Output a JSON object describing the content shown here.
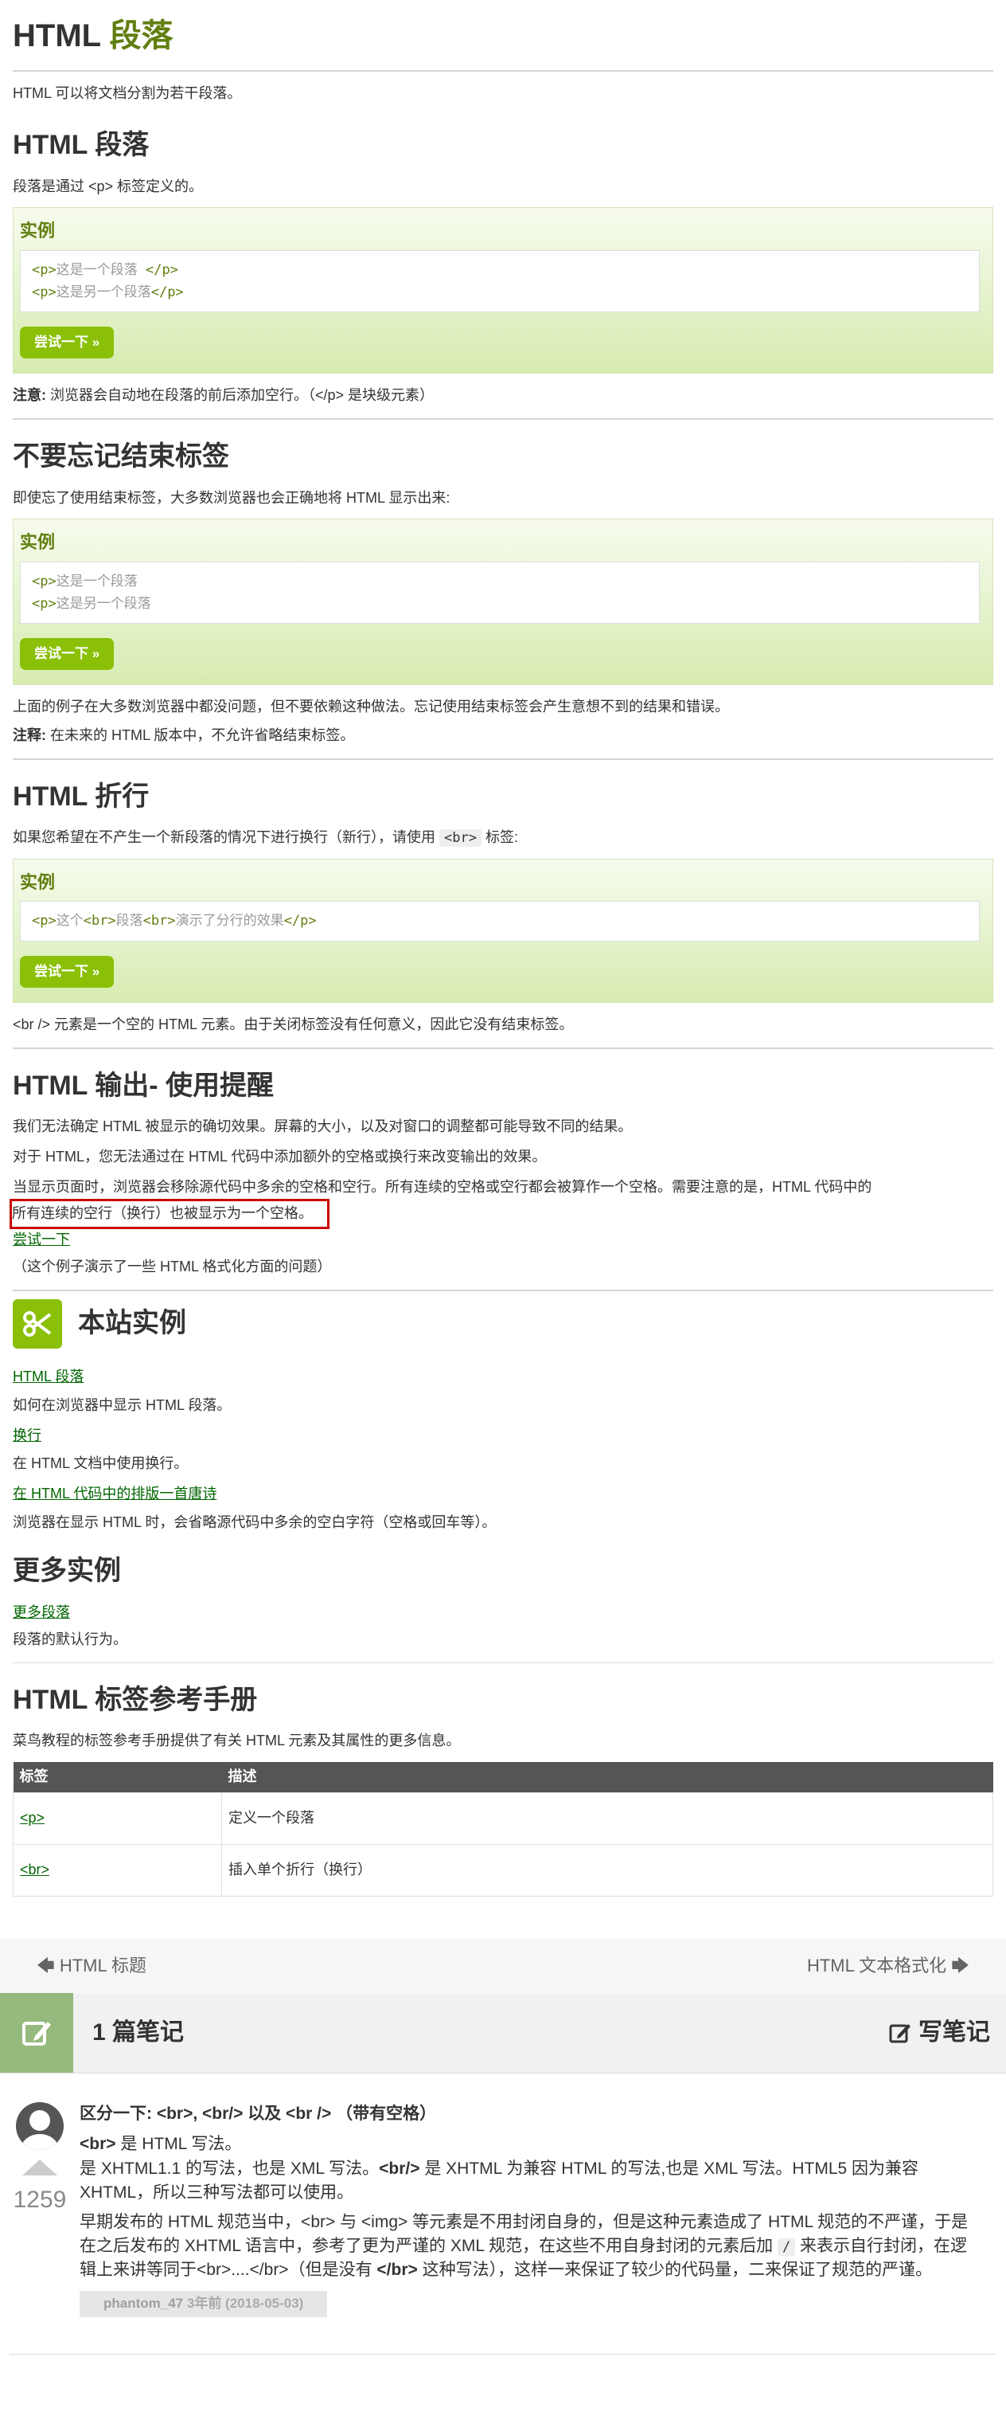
{
  "page": {
    "title_prefix": "HTML",
    "title_accent": "段落",
    "intro": "HTML 可以将文档分割为若干段落。"
  },
  "sections": {
    "s1": {
      "title": "HTML 段落",
      "desc": "段落是通过 <p> 标签定义的。",
      "example_label": "实例",
      "code": [
        {
          "open": "<p>",
          "text": "这是一个段落 ",
          "close": "</p>"
        },
        {
          "open": "<p>",
          "text": "这是另一个段落",
          "close": "</p>"
        }
      ],
      "try_label": "尝试一下 »",
      "note_label": "注意:",
      "note_text": " 浏览器会自动地在段落的前后添加空行。（</p> 是块级元素）"
    },
    "s2": {
      "title": "不要忘记结束标签",
      "desc": "即使忘了使用结束标签，大多数浏览器也会正确地将 HTML 显示出来:",
      "example_label": "实例",
      "code": [
        {
          "open": "<p>",
          "text": "这是一个段落",
          "close": ""
        },
        {
          "open": "<p>",
          "text": "这是另一个段落",
          "close": ""
        }
      ],
      "try_label": "尝试一下 »",
      "after": "上面的例子在大多数浏览器中都没问题，但不要依赖这种做法。忘记使用结束标签会产生意想不到的结果和错误。",
      "note_label": "注释:",
      "note_text": " 在未来的 HTML 版本中，不允许省略结束标签。"
    },
    "s3": {
      "title": "HTML 折行",
      "desc_before": "如果您希望在不产生一个新段落的情况下进行换行（新行），请使用 ",
      "desc_code": "<br>",
      "desc_after": " 标签:",
      "example_label": "实例",
      "code_parts": [
        "<p>",
        "这个",
        "<br>",
        "段落",
        "<br>",
        "演示了分行的效果",
        "</p>"
      ],
      "try_label": "尝试一下 »",
      "after": "<br /> 元素是一个空的 HTML 元素。由于关闭标签没有任何意义，因此它没有结束标签。"
    },
    "s4": {
      "title": "HTML 输出- 使用提醒",
      "p1": "我们无法确定 HTML 被显示的确切效果。屏幕的大小，以及对窗口的调整都可能导致不同的结果。",
      "p2": "对于 HTML，您无法通过在 HTML 代码中添加额外的空格或换行来改变输出的效果。",
      "p3": "当显示页面时，浏览器会移除源代码中多余的空格和空行。所有连续的空格或空行都会被算作一个空格。需要注意的是，HTML 代码中的",
      "p3_highlight": "所有连续的空行（换行）也被显示为一个空格。",
      "try_link": "尝试一下",
      "p4": "（这个例子演示了一些 HTML 格式化方面的问题）"
    },
    "site_examples": {
      "title": "本站实例",
      "items": [
        {
          "link": "HTML 段落",
          "desc": "如何在浏览器中显示 HTML 段落。"
        },
        {
          "link": "换行",
          "desc": "在 HTML 文档中使用换行。"
        },
        {
          "link": "在 HTML 代码中的排版一首唐诗",
          "desc": "浏览器在显示 HTML 时，会省略源代码中多余的空白字符（空格或回车等）。"
        }
      ]
    },
    "more_examples": {
      "title": "更多实例",
      "link": "更多段落",
      "desc": "段落的默认行为。"
    },
    "reference": {
      "title": "HTML 标签参考手册",
      "desc": "菜鸟教程的标签参考手册提供了有关 HTML 元素及其属性的更多信息。",
      "headers": [
        "标签",
        "描述"
      ],
      "rows": [
        {
          "tag": "<p>",
          "desc": "定义一个段落"
        },
        {
          "tag": "<br>",
          "desc": "插入单个折行（换行）"
        }
      ]
    }
  },
  "nav": {
    "prev": "HTML 标题",
    "next": "HTML 文本格式化"
  },
  "notes": {
    "count_label": "1 篇笔记",
    "write_label": "写笔记",
    "items": [
      {
        "question": "区分一下: <br>, <br/> 以及 <br /> （带有空格）",
        "votes": "1259",
        "line1_bold": "<br>",
        "line1": " 是 HTML 写法。",
        "line2": "是 XHTML1.1 的写法，也是 XML 写法。",
        "line2_bold": "<br/>",
        "line2b": " 是 XHTML 为兼容 HTML 的写法,也是 XML 写法。HTML5 因为兼容 XHTML，所以三种写法都可以使用。",
        "para2_a": "早期发布的 HTML 规范当中，<br> 与 <img> 等元素是不用封闭自身的，但是这种元素造成了 HTML 规范的不严谨，于是在之后发布的 XHTML 语言中，参考了更为严谨的 XML 规范，在这些不用自身封闭的元素后加 ",
        "para2_code": "/",
        "para2_b": " 来表示自行封闭，在逻辑上来讲等同于<br>....</br>（但是没有 ",
        "para2_bold": "</br>",
        "para2_c": " 这种写法），这样一来保证了较少的代码量，二来保证了规范的严谨。",
        "author": "phantom_47",
        "time": "3年前 (2018-05-03)"
      }
    ]
  },
  "colors": {
    "accent_green": "#617f10",
    "button_green": "#8ac007",
    "highlight_red": "#cc0000"
  }
}
